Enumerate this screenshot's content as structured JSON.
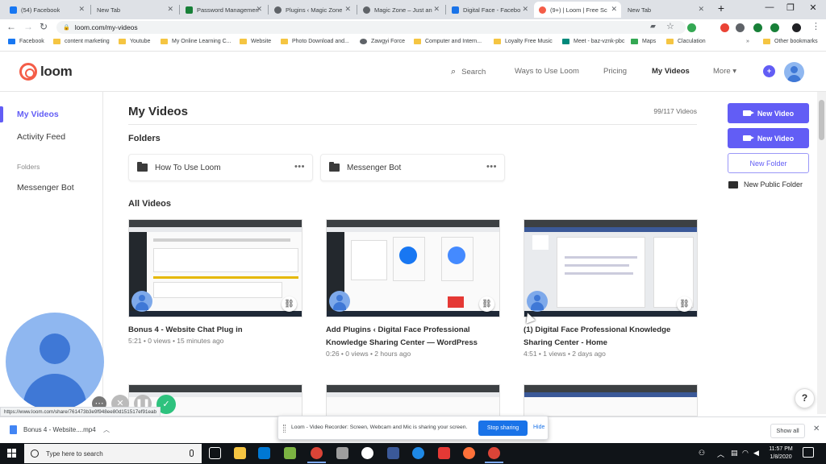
{
  "browser": {
    "tabs": [
      {
        "label": "(54) Facebook",
        "color": "#1877f2"
      },
      {
        "label": "New Tab",
        "color": "#ffffff"
      },
      {
        "label": "Password Managemen",
        "color": "#188038"
      },
      {
        "label": "Plugins ‹ Magic Zone",
        "color": "#5f6368"
      },
      {
        "label": "Magic Zone – Just an",
        "color": "#5f6368"
      },
      {
        "label": "Digital Face - Facebo",
        "color": "#1a73e8"
      },
      {
        "label": "(9+) | Loom | Free Sc",
        "color": "#f45d48"
      },
      {
        "label": "New Tab",
        "color": "#ffffff"
      }
    ],
    "url": "loom.com/my-videos",
    "bookmarks": [
      "Facebook",
      "content marketing",
      "Youtube",
      "My Online Learning C...",
      "Website",
      "Photo Download and...",
      "Zawgyi Force",
      "Computer and Intern...",
      "Loyalty Free Music",
      "Meet - baz-vznk-pbc",
      "Maps",
      "Claculation",
      "Other bookmarks"
    ]
  },
  "header": {
    "logo": "loom",
    "search": "Search",
    "nav": [
      "Ways to Use Loom",
      "Pricing",
      "My Videos",
      "More ▾"
    ],
    "accent": "#625df5"
  },
  "sidebar": {
    "items": [
      "My Videos",
      "Activity Feed"
    ],
    "folders_heading": "Folders",
    "folders": [
      "Messenger Bot"
    ]
  },
  "main": {
    "title": "My Videos",
    "count": "99/117 Videos",
    "folders_heading": "Folders",
    "folders": [
      "How To Use Loom",
      "Messenger Bot"
    ],
    "videos_heading": "All Videos",
    "videos": [
      {
        "title": "Bonus 4 - Website Chat Plug in",
        "meta": "5:21 • 0 views • 15 minutes ago"
      },
      {
        "title": "Add Plugins ‹ Digital Face Professional Knowledge Sharing Center — WordPress",
        "meta": "0:26 • 0 views • 2 hours ago"
      },
      {
        "title": "(1) Digital Face Professional Knowledge Sharing Center - Home",
        "meta": "4:51 • 1 views • 2 days ago"
      }
    ]
  },
  "actions": {
    "new_video": "New Video",
    "new_video_2": "New Video",
    "new_folder": "New Folder",
    "new_public_folder": "New Public Folder"
  },
  "help": "?",
  "status_url": "https://www.loom.com/share/761473b3e9f948ee80d151517ef91eab",
  "downloads": {
    "file": "Bonus 4 - Website....mp4",
    "show_all": "Show all"
  },
  "share_bar": {
    "message": "Loom - Video Recorder: Screen, Webcam and Mic is sharing your screen.",
    "stop": "Stop sharing",
    "hide": "Hide"
  },
  "taskbar": {
    "search_placeholder": "Type here to search",
    "time": "11:57 PM",
    "date": "1/8/2020"
  }
}
